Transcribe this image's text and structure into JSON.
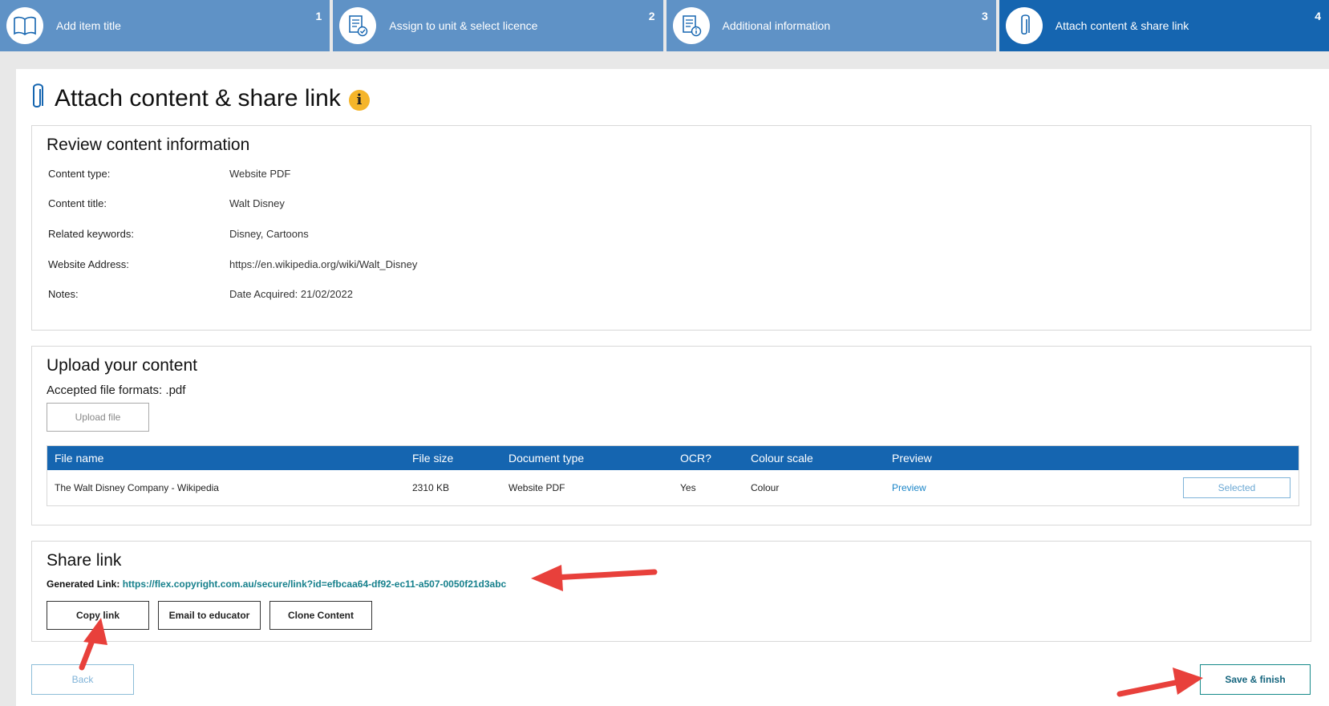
{
  "stepper": [
    {
      "label": "Add item title",
      "number": "1",
      "icon": "book-icon",
      "active": false
    },
    {
      "label": "Assign to unit & select licence",
      "number": "2",
      "icon": "document-check-icon",
      "active": false
    },
    {
      "label": "Additional information",
      "number": "3",
      "icon": "document-info-icon",
      "active": false
    },
    {
      "label": "Attach content & share link",
      "number": "4",
      "icon": "paperclip-icon",
      "active": true
    }
  ],
  "page_title": "Attach content & share link",
  "info_icon": "i",
  "review": {
    "heading": "Review content information",
    "rows": [
      {
        "key": "Content type:",
        "value": "Website PDF"
      },
      {
        "key": "Content title:",
        "value": "Walt Disney"
      },
      {
        "key": "Related keywords:",
        "value": "Disney, Cartoons"
      },
      {
        "key": "Website Address:",
        "value": "https://en.wikipedia.org/wiki/Walt_Disney"
      },
      {
        "key": "Notes:",
        "value": "Date Acquired: 21/02/2022"
      }
    ]
  },
  "upload": {
    "heading": "Upload your content",
    "formats": "Accepted file formats: .pdf",
    "upload_button": "Upload file",
    "table": {
      "headers": [
        "File name",
        "File size",
        "Document type",
        "OCR?",
        "Colour scale",
        "Preview"
      ],
      "rows": [
        {
          "file_name": "The Walt Disney Company - Wikipedia",
          "file_size": "2310 KB",
          "doc_type": "Website PDF",
          "ocr": "Yes",
          "colour": "Colour",
          "preview": "Preview",
          "action": "Selected"
        }
      ]
    }
  },
  "share": {
    "heading": "Share link",
    "generated_label": "Generated Link:",
    "url": "https://flex.copyright.com.au/secure/link?id=efbcaa64-df92-ec11-a507-0050f21d3abc",
    "copy_button": "Copy link",
    "email_button": "Email to educator",
    "clone_button": "Clone Content"
  },
  "footer": {
    "back_button": "Back",
    "save_button": "Save & finish"
  },
  "colors": {
    "step_bg": "#5f92c6",
    "step_active_bg": "#1565b0",
    "table_header_bg": "#1565b0",
    "annotation_arrow": "#e8403b",
    "info_badge": "#f5b52a"
  }
}
